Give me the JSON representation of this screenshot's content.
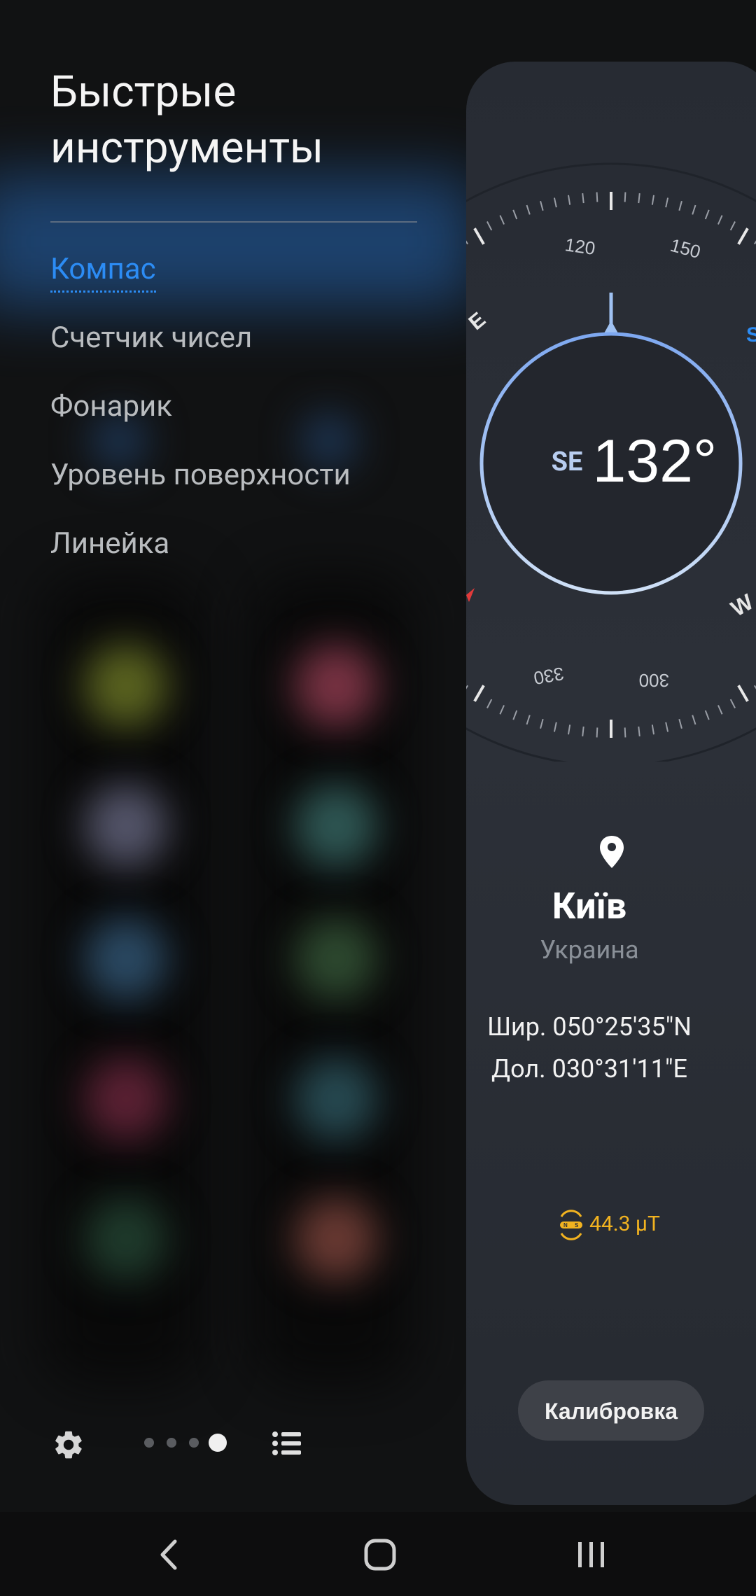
{
  "panel_title": "Быстрые инструменты",
  "menu": {
    "items": [
      {
        "label": "Компас",
        "active": true
      },
      {
        "label": "Счетчик чисел",
        "active": false
      },
      {
        "label": "Фонарик",
        "active": false
      },
      {
        "label": "Уровень поверхности",
        "active": false
      },
      {
        "label": "Линейка",
        "active": false
      }
    ]
  },
  "compass": {
    "heading_dir": "SE",
    "heading_deg": "132°",
    "dial_labels": [
      "120",
      "150",
      "330",
      "300"
    ],
    "cardinal_labels": [
      "E",
      "S",
      "W"
    ],
    "location": {
      "city": "Київ",
      "country": "Украина",
      "lat": "Шир. 050°25'35\"N",
      "lon": "Дол. 030°31'11\"E"
    },
    "magnetic": "44.3 μT",
    "calibrate_label": "Калибровка",
    "accent_color": "#2c8cf4",
    "ring_color": "#a9c6f5",
    "mag_color": "#f2b320"
  },
  "pager": {
    "pages": 4,
    "current": 4
  },
  "icons": {
    "settings": "gear-icon",
    "list": "list-icon",
    "location": "location-pin-icon",
    "magnet": "magnetic-sensor-icon",
    "back": "back-icon",
    "home": "home-icon",
    "recents": "recents-icon"
  }
}
